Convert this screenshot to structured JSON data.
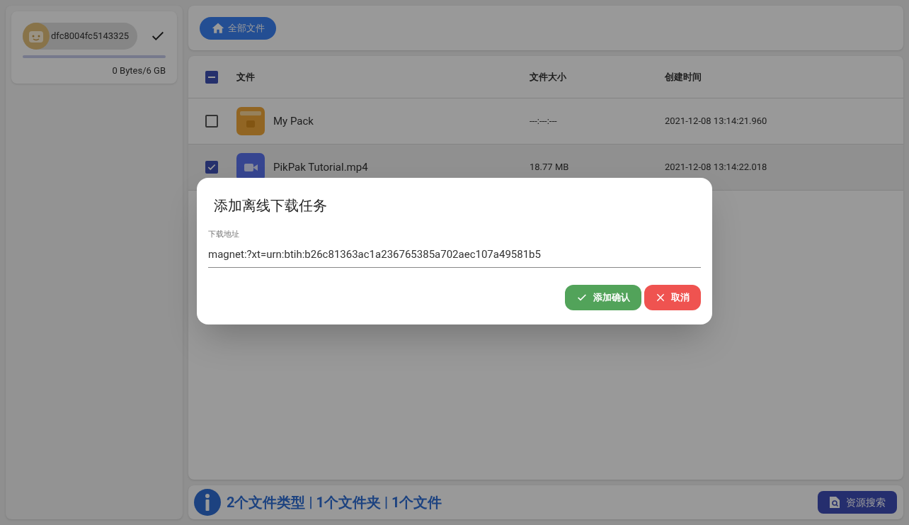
{
  "account": {
    "name": "dfc8004fc5143325",
    "active": true,
    "usage": "0 Bytes/6 GB"
  },
  "toolbar": {
    "home_button": "全部文件"
  },
  "table": {
    "header_checkbox": {
      "indeterminate": true
    },
    "columns": [
      "文件",
      "文件大小",
      "创建时间"
    ],
    "rows": [
      {
        "kind": "folder",
        "name": "My Pack",
        "size": "---:---:---",
        "created": "2021-12-08 13:14:21.960",
        "checked": false
      },
      {
        "kind": "video",
        "name": "PikPak Tutorial.mp4",
        "size": "18.77 MB",
        "created": "2021-12-08 13:14:22.018",
        "checked": true
      }
    ]
  },
  "status_bar": {
    "summary": "2个文件类型 | 1个文件夹 | 1个文件",
    "search_button": "资源搜索"
  },
  "dialog": {
    "title": "添加离线下载任务",
    "field_label": "下载地址",
    "field_value": "magnet:?xt=urn:btih:b26c81363ac1a236765385a702aec107a49581b5",
    "confirm_button": "添加确认",
    "cancel_button": "取消"
  }
}
